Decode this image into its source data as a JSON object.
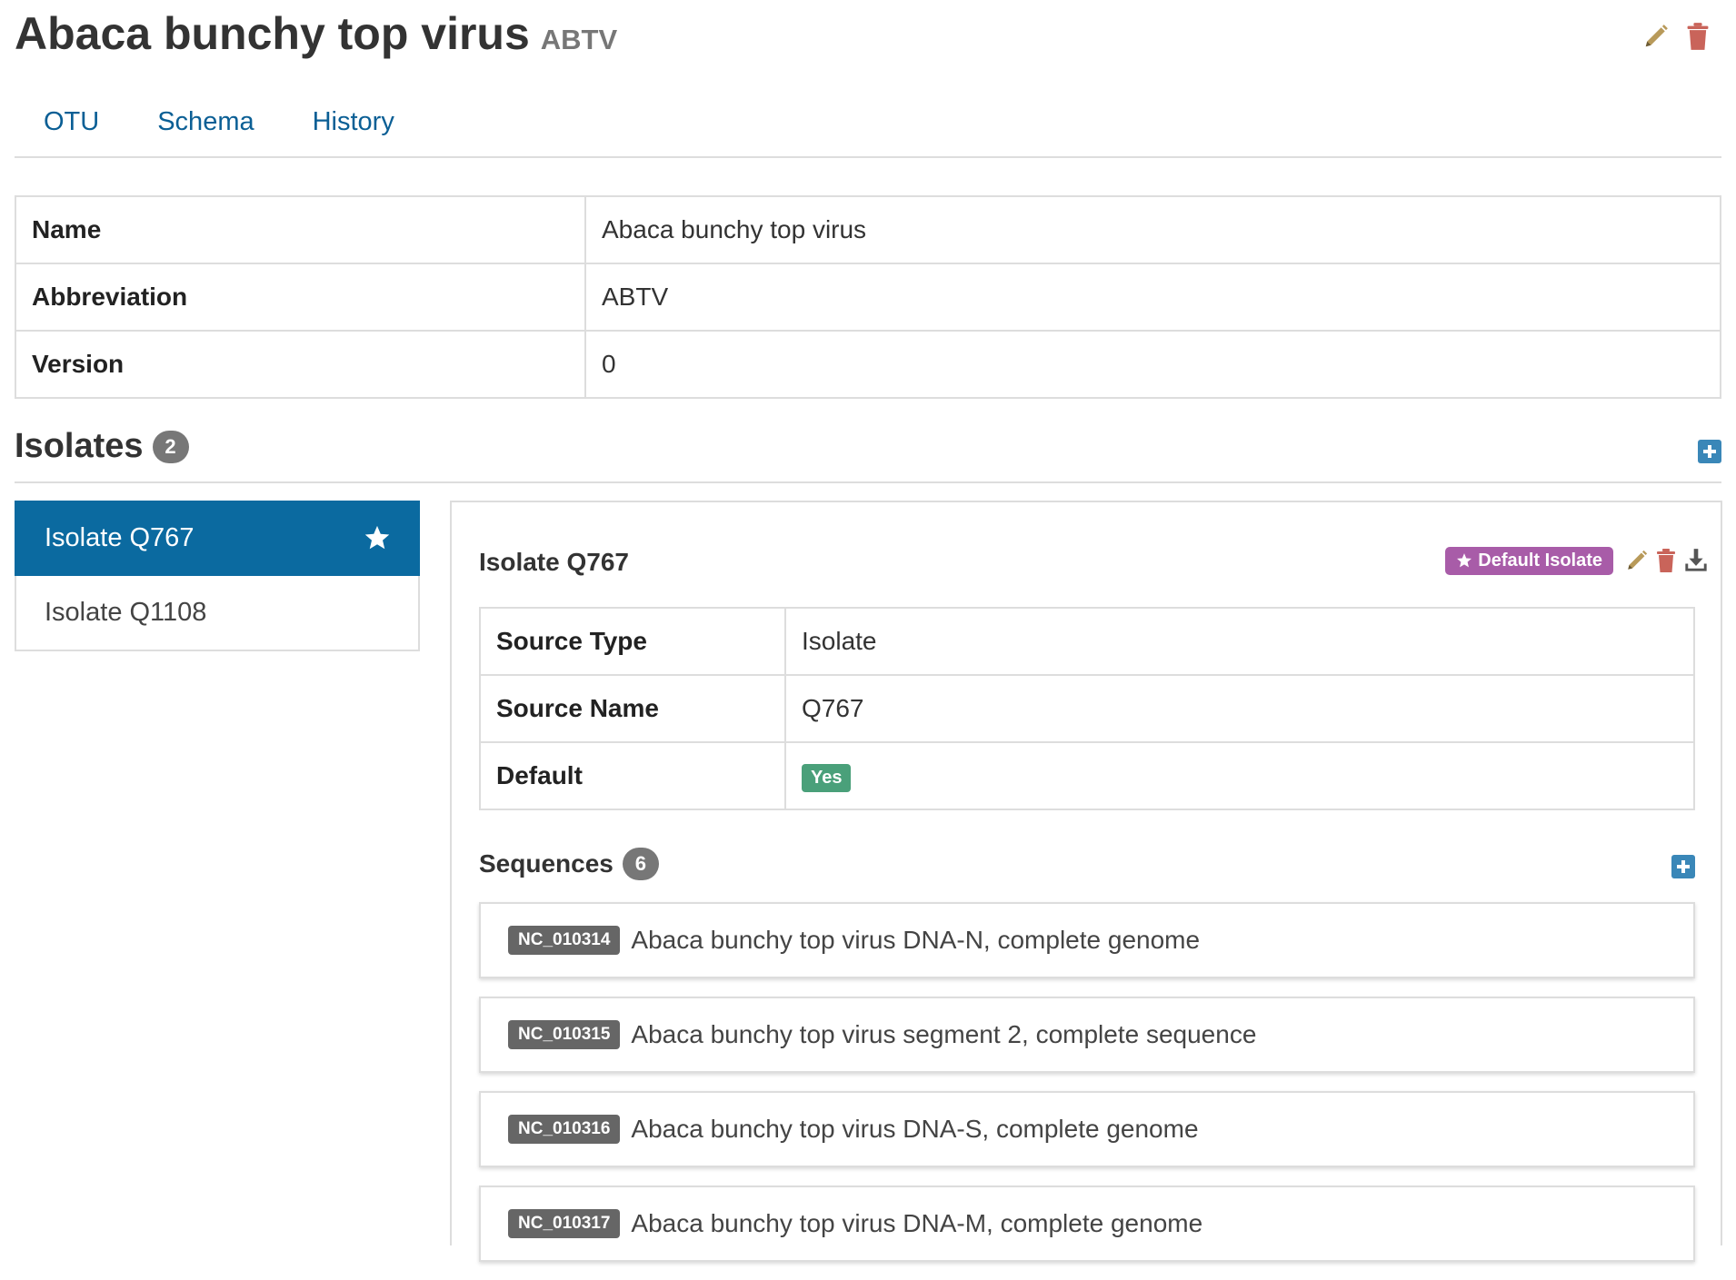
{
  "header": {
    "title": "Abaca bunchy top virus",
    "abbreviation": "ABTV"
  },
  "tabs": [
    {
      "label": "OTU"
    },
    {
      "label": "Schema"
    },
    {
      "label": "History"
    }
  ],
  "otu_info": [
    {
      "key": "Name",
      "value": "Abaca bunchy top virus"
    },
    {
      "key": "Abbreviation",
      "value": "ABTV"
    },
    {
      "key": "Version",
      "value": "0"
    }
  ],
  "isolates": {
    "title": "Isolates",
    "count": "2",
    "items": [
      {
        "label": "Isolate Q767",
        "active": true
      },
      {
        "label": "Isolate Q1108",
        "active": false
      }
    ]
  },
  "isolate_detail": {
    "title": "Isolate Q767",
    "default_label": "Default Isolate",
    "rows": [
      {
        "key": "Source Type",
        "value": "Isolate"
      },
      {
        "key": "Source Name",
        "value": "Q767"
      },
      {
        "key": "Default",
        "value": "Yes"
      }
    ]
  },
  "sequences": {
    "title": "Sequences",
    "count": "6",
    "items": [
      {
        "accession": "NC_010314",
        "definition": "Abaca bunchy top virus DNA-N, complete genome"
      },
      {
        "accession": "NC_010315",
        "definition": "Abaca bunchy top virus segment 2, complete sequence"
      },
      {
        "accession": "NC_010316",
        "definition": "Abaca bunchy top virus DNA-S, complete genome"
      },
      {
        "accession": "NC_010317",
        "definition": "Abaca bunchy top virus DNA-M, complete genome"
      }
    ]
  },
  "colors": {
    "link": "#0b5f95",
    "active": "#0b6aa0",
    "danger": "#c9645a",
    "edit": "#b89a5a",
    "default_label": "#a85ca8",
    "success": "#4aa07a"
  },
  "icons": {
    "edit": "pencil-icon",
    "remove": "trash-icon",
    "add": "plus-square-icon",
    "default": "star-icon",
    "download": "download-icon"
  }
}
